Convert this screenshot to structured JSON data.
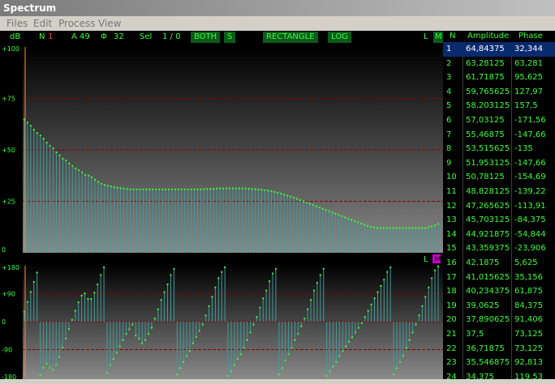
{
  "window": {
    "title": "Spectrum"
  },
  "menu": [
    "Files",
    "Edit",
    "Process",
    "View"
  ],
  "toolbar": {
    "db_label": "dB",
    "n_label": "N",
    "n_value": "1",
    "a_label": "A",
    "a_value": "49",
    "phi_label": "Φ",
    "phi_value": "32",
    "sel_label": "Sel",
    "sel_value": "1 / 0",
    "both": "BOTH",
    "s": "S",
    "window_type": "RECTANGLE",
    "log": "LOG",
    "l": "L",
    "m": "M"
  },
  "amplitude_plot": {
    "y_ticks": [
      "+100",
      "+75",
      "+50",
      "+25",
      "0"
    ],
    "ylim": [
      0,
      100
    ],
    "values": [
      64.8,
      63.3,
      61.7,
      59.8,
      58.2,
      57.0,
      55.5,
      53.5,
      52.0,
      50.8,
      48.8,
      47.3,
      45.7,
      44.9,
      43.4,
      42.2,
      41.0,
      40.2,
      39.1,
      37.9,
      37.5,
      36.7,
      35.5,
      34.4,
      33.5,
      33.0,
      32.5,
      32.2,
      31.9,
      31.6,
      31.4,
      31.2,
      31.0,
      30.9,
      30.8,
      30.8,
      30.8,
      30.8,
      30.8,
      30.8,
      30.8,
      30.8,
      30.8,
      30.8,
      30.8,
      30.8,
      30.8,
      30.8,
      30.8,
      30.8,
      30.8,
      30.8,
      30.8,
      30.8,
      30.8,
      30.8,
      30.9,
      31.0,
      31.0,
      31.1,
      31.2,
      31.2,
      31.2,
      31.3,
      31.3,
      31.3,
      31.3,
      31.3,
      31.3,
      31.2,
      31.1,
      31.0,
      30.9,
      30.8,
      30.6,
      30.4,
      30.2,
      29.9,
      29.6,
      29.2,
      28.8,
      28.3,
      27.8,
      27.3,
      26.8,
      26.2,
      25.6,
      25.0,
      24.4,
      23.8,
      23.2,
      22.6,
      22.0,
      21.4,
      20.8,
      20.2,
      19.6,
      19.0,
      18.4,
      17.8,
      17.2,
      16.6,
      16.0,
      15.4,
      14.8,
      14.2,
      13.6,
      13.0,
      12.6,
      12.3,
      12.1,
      12.0,
      12.0,
      12.0,
      12.0,
      12.0,
      12.0,
      12.0,
      12.0,
      12.0,
      12.0,
      12.0,
      12.0,
      12.0,
      12.0,
      12.0,
      12.3,
      12.8,
      13.4,
      14.0
    ]
  },
  "phase_plot": {
    "y_ticks": [
      "+180",
      "+90",
      "0",
      "-90",
      "-180"
    ],
    "ylim": [
      -180,
      180
    ],
    "values": [
      32,
      63,
      96,
      128,
      158,
      -172,
      -148,
      -135,
      -148,
      -155,
      -139,
      -114,
      -84,
      -55,
      -24,
      6,
      35,
      62,
      84,
      91,
      73,
      73,
      93,
      120,
      150,
      175,
      -165,
      -140,
      -120,
      -100,
      -80,
      -60,
      -40,
      -25,
      -10,
      -45,
      -55,
      -70,
      -60,
      -40,
      -20,
      10,
      40,
      70,
      95,
      120,
      150,
      170,
      -170,
      -150,
      -130,
      -110,
      -95,
      -70,
      -50,
      -30,
      -10,
      20,
      50,
      80,
      110,
      140,
      160,
      175,
      -175,
      -160,
      -140,
      -120,
      -105,
      -85,
      -60,
      -35,
      -10,
      15,
      45,
      75,
      100,
      130,
      155,
      170,
      -170,
      -150,
      -125,
      -105,
      -85,
      -60,
      -40,
      -15,
      10,
      40,
      70,
      100,
      125,
      150,
      170,
      -175,
      -160,
      -145,
      -130,
      -110,
      -95,
      -80,
      -65,
      -50,
      -35,
      -20,
      -5,
      15,
      35,
      55,
      75,
      95,
      115,
      135,
      160,
      175,
      -170,
      -150,
      -130,
      -110,
      -85,
      -60,
      -35,
      -10,
      20,
      50,
      80,
      110,
      140,
      165,
      178
    ]
  },
  "table": {
    "headers": [
      "N",
      "Amplitude",
      "Phase"
    ],
    "rows": [
      [
        "1",
        "64,84375",
        "32,344"
      ],
      [
        "2",
        "63,28125",
        "63,281"
      ],
      [
        "3",
        "61,71875",
        "95,625"
      ],
      [
        "4",
        "59,765625",
        "127,97"
      ],
      [
        "5",
        "58,203125",
        "157,5"
      ],
      [
        "6",
        "57,03125",
        "-171,56"
      ],
      [
        "7",
        "55,46875",
        "-147,66"
      ],
      [
        "8",
        "53,515625",
        "-135"
      ],
      [
        "9",
        "51,953125",
        "-147,66"
      ],
      [
        "10",
        "50,78125",
        "-154,69"
      ],
      [
        "11",
        "48,828125",
        "-139,22"
      ],
      [
        "12",
        "47,265625",
        "-113,91"
      ],
      [
        "13",
        "45,703125",
        "-84,375"
      ],
      [
        "14",
        "44,921875",
        "-54,844"
      ],
      [
        "15",
        "43,359375",
        "-23,906"
      ],
      [
        "16",
        "42,1875",
        "5,625"
      ],
      [
        "17",
        "41,015625",
        "35,156"
      ],
      [
        "18",
        "40,234375",
        "61,875"
      ],
      [
        "19",
        "39,0625",
        "84,375"
      ],
      [
        "20",
        "37,890625",
        "91,406"
      ],
      [
        "21",
        "37,5",
        "73,125"
      ],
      [
        "22",
        "36,71875",
        "73,125"
      ],
      [
        "23",
        "35,546875",
        "92,813"
      ],
      [
        "24",
        "34,375",
        "119,53"
      ]
    ]
  },
  "colors": {
    "bar": "#3c9e9a",
    "point": "#39ff39",
    "marker": "#ff8a3c",
    "grid": "#8b0000"
  }
}
